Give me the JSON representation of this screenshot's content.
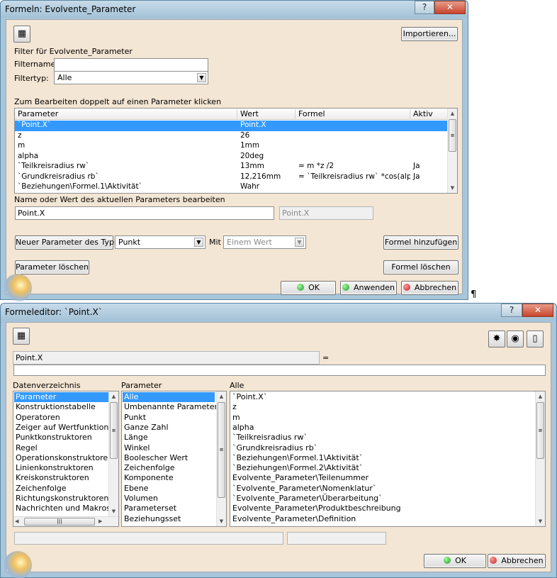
{
  "win1": {
    "title": "Formeln: Evolvente_Parameter",
    "help": "?",
    "close": "✕",
    "import_label": "Importieren...",
    "filter_heading": "Filter für Evolvente_Parameter",
    "filtername_label": "Filtername:",
    "filtername_value": "",
    "filtertyp_label": "Filtertyp:",
    "filtertyp_value": "Alle",
    "edit_hint": "Zum Bearbeiten doppelt auf einen Parameter klicken",
    "columns": [
      "Parameter",
      "Wert",
      "Formel",
      "Aktiv"
    ],
    "rows": [
      [
        "`Point.X`",
        "Point.X",
        "",
        ""
      ],
      [
        "z",
        "26",
        "",
        ""
      ],
      [
        "m",
        "1mm",
        "",
        ""
      ],
      [
        "alpha",
        "20deg",
        "",
        ""
      ],
      [
        "`Teilkreisradius rw`",
        "13mm",
        "= m *z /2",
        "Ja"
      ],
      [
        "`Grundkreisradius rb`",
        "12,216mm",
        "= `Teilkreisradius rw` *cos(alp...",
        "Ja"
      ],
      [
        "`Beziehungen\\Formel.1\\Aktivität`",
        "Wahr",
        "",
        ""
      ]
    ],
    "edit_label": "Name oder Wert des aktuellen Parameters bearbeiten",
    "edit_name": "Point.X",
    "edit_value": "Point.X",
    "new_param_label": "Neuer Parameter des Typs",
    "new_param_type": "Punkt",
    "mit_label": "Mit",
    "mit_value": "Einem Wert",
    "add_formula_label": "Formel hinzufügen",
    "delete_param_label": "Parameter löschen",
    "delete_formula_label": "Formel löschen",
    "ok_label": "OK",
    "apply_label": "Anwenden",
    "cancel_label": "Abbrechen"
  },
  "pilcrow": "¶",
  "win2": {
    "title": "Formeleditor: `Point.X`",
    "help": "?",
    "close": "✕",
    "param_name": "Point.X",
    "equals": "=",
    "formula_value": "",
    "col1_label": "Datenverzeichnis",
    "col2_label": "Parameter",
    "col3_label": "Alle",
    "list1": [
      "Parameter",
      "Konstruktionstabelle",
      "Operatoren",
      "Zeiger auf Wertfunktionen",
      "Punktkonstruktoren",
      "Regel",
      "Operationskonstruktoren",
      "Linienkonstruktoren",
      "Kreiskonstruktoren",
      "Zeichenfolge",
      "Richtungskonstruktoren",
      "Nachrichten und Makros"
    ],
    "list2": [
      "Alle",
      "Umbenannte Parameter",
      "Punkt",
      "Ganze Zahl",
      "Länge",
      "Winkel",
      "Boolescher Wert",
      "Zeichenfolge",
      "Komponente",
      "Ebene",
      "Volumen",
      "Parameterset",
      "Beziehungsset"
    ],
    "list3": [
      "`Point.X`",
      "z",
      "m",
      "alpha",
      "`Teilkreisradius rw`",
      "`Grundkreisradius rb`",
      "`Beziehungen\\Formel.1\\Aktivität`",
      "`Beziehungen\\Formel.2\\Aktivität`",
      "Evolvente_Parameter\\Teilenummer",
      "`Evolvente_Parameter\\Nomenklatur`",
      "`Evolvente_Parameter\\Überarbeitung`",
      "Evolvente_Parameter\\Produktbeschreibung",
      "Evolvente_Parameter\\Definition"
    ],
    "ok_label": "OK",
    "cancel_label": "Abbrechen"
  }
}
